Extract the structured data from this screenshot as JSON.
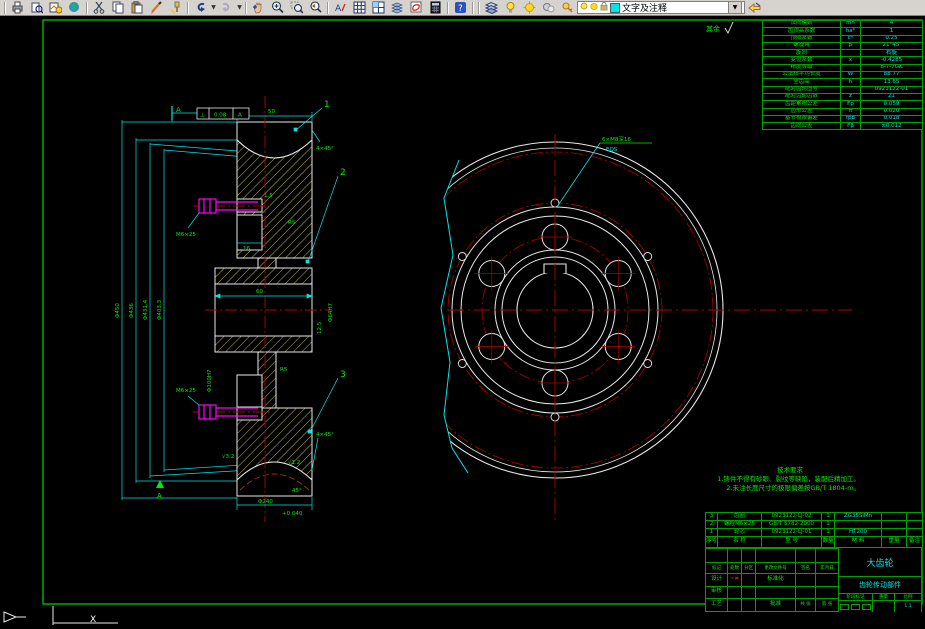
{
  "toolbar": {
    "layer_dropdown_value": "文字及注释",
    "dropdown_arrow": "▼",
    "icons": [
      "print",
      "print-preview",
      "plot",
      "publish",
      "cut",
      "copy",
      "paste",
      "pencil-edit",
      "match-properties",
      "undo",
      "redo",
      "pan-hand",
      "zoom-realtime",
      "zoom-window",
      "zoom-previous",
      "text-style",
      "table-grid",
      "cell-grid",
      "wave-stack",
      "named-views",
      "calculator",
      "help",
      "layer-stack",
      "bulb",
      "sun",
      "lock",
      "printer-state",
      "color-swatch",
      "layer-previous"
    ],
    "accent_color": "#00e5e5"
  },
  "surface_note": {
    "label": "其余",
    "symbol": "√"
  },
  "left_view": {
    "balloons": [
      "1",
      "2",
      "3"
    ],
    "gdt": {
      "sym": "⊥",
      "val": "0.08",
      "datum": "A"
    },
    "dims": {
      "face_width": "50",
      "chamfer_top": "4×45°",
      "d1": "Φ450",
      "d2": "Φ436",
      "d3": "Φ431.4",
      "d4": "Φ403.3",
      "hub_len": "60",
      "pocket": "16",
      "t15": "1.5",
      "r_top": "R5",
      "depth": "12.5",
      "bore": "Φ64H7",
      "hub_bore": "Φ100H7",
      "bolt": "M6×25",
      "r_bot": "R5",
      "chamfer_bot": "4×45°",
      "angle_bot": "45°",
      "bottom_dia": "Φ240",
      "bottom_tol": "+0.040",
      "rough1": "√3.2",
      "rough2": "√1.2",
      "datum": "A",
      "section": "A"
    }
  },
  "right_view": {
    "hole_note": "6×M8深16",
    "eqs": "EQS"
  },
  "param_table": {
    "rows": [
      {
        "label": "法向模数",
        "sym": "mn",
        "val": "4"
      },
      {
        "label": "齿顶高系数",
        "sym": "ha*",
        "val": "1"
      },
      {
        "label": "顶隙系数",
        "sym": "c*",
        "val": "0.25"
      },
      {
        "label": "螺旋角",
        "sym": "β",
        "val": "21°45′"
      },
      {
        "label": "旋向",
        "sym": "",
        "val": "右旋"
      },
      {
        "label": "变位系数",
        "sym": "x",
        "val": "-0.4285"
      },
      {
        "label": "精度等级",
        "sym": "",
        "val": "8-7-7GK"
      },
      {
        "label": "公法线平均长度",
        "sym": "W",
        "val": "88.77"
      },
      {
        "label": "全齿高",
        "sym": "h",
        "val": "13.65"
      },
      {
        "label": "配对齿轮图号",
        "sym": "",
        "val": "0923122-01"
      },
      {
        "label": "配对齿轮齿数",
        "sym": "z",
        "val": "21"
      },
      {
        "label": "齿距累积公差",
        "sym": "Fp",
        "val": "0.059"
      },
      {
        "label": "齿形公差",
        "sym": "ff",
        "val": "0.020"
      },
      {
        "label": "基节极限偏差",
        "sym": "fpb",
        "val": "0.018"
      },
      {
        "label": "齿向公差",
        "sym": "Fβ",
        "val": "±0.012"
      }
    ]
  },
  "notes": {
    "title": "技术要求",
    "line1": "1.铸件不得有砂眼、裂纹等缺陷，装配后精加工。",
    "line2": "2.未注长度尺寸的极限偏差按GB/T 1804-m。"
  },
  "title_block": {
    "parts": [
      {
        "no": "3",
        "name": "齿圈",
        "code": "0923122-LJ-02",
        "qty": "1",
        "material": "ZG35SiMn",
        "remark": ""
      },
      {
        "no": "2",
        "name": "螺栓M6×25",
        "code": "GB/T 5782-2000",
        "qty": "1",
        "material": "",
        "remark": ""
      },
      {
        "no": "1",
        "name": "轮芯",
        "code": "0923122-LJ-01",
        "qty": "1",
        "material": "HT200",
        "remark": ""
      }
    ],
    "headers": {
      "no": "序号",
      "name": "名 称",
      "code": "型 号",
      "qty": "数量",
      "material": "材 料",
      "weight": "重量",
      "remark": "备注"
    },
    "sign_headers": [
      "标记",
      "处数",
      "分区",
      "更改文件号",
      "签名",
      "年月日"
    ],
    "roles": {
      "design": "设计",
      "standard": "标准化",
      "audit": "审核",
      "craft": "工艺",
      "approve": "批准"
    },
    "design_mark": "~≠",
    "sheets_total": "共 张",
    "sheet_no": "第 张",
    "stage": "阶段标记",
    "weight_label": "重量",
    "scale_label": "比例",
    "scale": "1:1",
    "part_name": "大齿轮",
    "assembly_name": "齿轮传动部件"
  },
  "ucs": {
    "x_label": "X"
  }
}
